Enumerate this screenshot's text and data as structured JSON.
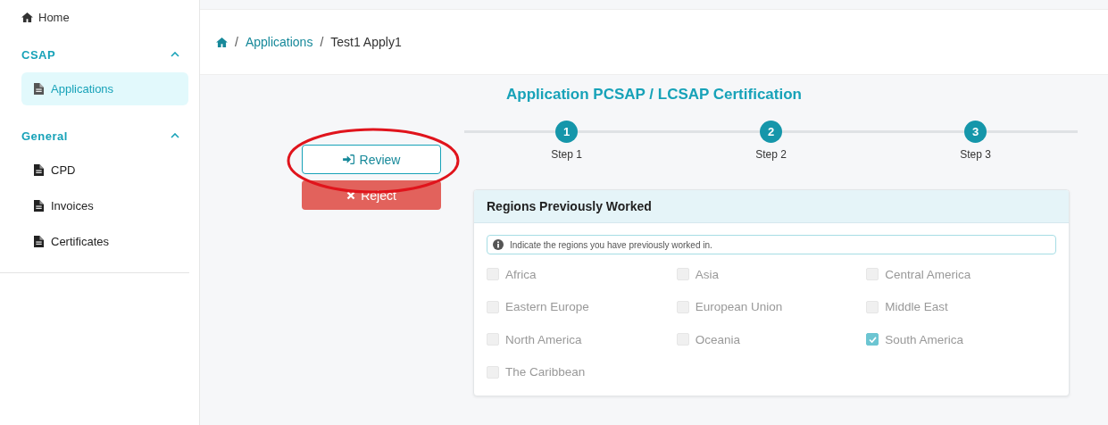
{
  "sidebar": {
    "home": {
      "label": "Home"
    },
    "groups": [
      {
        "title": "CSAP",
        "expanded": true,
        "items": [
          {
            "label": "Applications",
            "selected": true
          }
        ]
      },
      {
        "title": "General",
        "expanded": true,
        "items": [
          {
            "label": "CPD",
            "selected": false
          },
          {
            "label": "Invoices",
            "selected": false
          },
          {
            "label": "Certificates",
            "selected": false
          }
        ]
      }
    ]
  },
  "breadcrumb": [
    {
      "separator": "/",
      "label": "Applications"
    },
    {
      "separator": "/",
      "label": "Test1 Apply1"
    }
  ],
  "title": "Application PCSAP / LCSAP Certification",
  "actions": [
    {
      "label": "Review",
      "kind": "review"
    },
    {
      "label": "Reject",
      "kind": "reject"
    }
  ],
  "steps": [
    {
      "number": "1",
      "label": "Step 1"
    },
    {
      "number": "2",
      "label": "Step 2"
    },
    {
      "number": "3",
      "label": "Step 3"
    }
  ],
  "card": {
    "title": "Regions Previously Worked",
    "info": "Indicate the regions you have previously worked in.",
    "regions": [
      {
        "label": "Africa",
        "checked": false,
        "disabled": true
      },
      {
        "label": "Asia",
        "checked": false,
        "disabled": true
      },
      {
        "label": "Central America",
        "checked": false,
        "disabled": true
      },
      {
        "label": "Eastern Europe",
        "checked": false,
        "disabled": true
      },
      {
        "label": "European Union",
        "checked": false,
        "disabled": true
      },
      {
        "label": "Middle East",
        "checked": false,
        "disabled": true
      },
      {
        "label": "North America",
        "checked": false,
        "disabled": true
      },
      {
        "label": "Oceania",
        "checked": false,
        "disabled": true
      },
      {
        "label": "South America",
        "checked": true,
        "disabled": true
      },
      {
        "label": "The Caribbean",
        "checked": false,
        "disabled": true
      }
    ]
  }
}
